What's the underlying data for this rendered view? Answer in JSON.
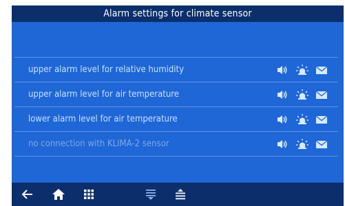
{
  "title": "Alarm settings for climate sensor",
  "alarms": [
    {
      "label": "upper alarm level for relative humidity"
    },
    {
      "label": "upper alarm level for air temperature"
    },
    {
      "label": "lower alarm level for air temperature"
    },
    {
      "label": "no connection with KLIMA-2 sensor"
    }
  ],
  "row_icons": [
    "speaker-icon",
    "beacon-icon",
    "envelope-icon"
  ],
  "nav_icons": [
    "back-arrow-icon",
    "home-icon",
    "grid-menu-icon",
    "scroll-down-icon",
    "scroll-up-icon"
  ],
  "colors": {
    "background": "#1f66d6",
    "title_bar": "#0b2f6b",
    "label_text": "#c4e0ff",
    "icon": "#d6e9ff",
    "divider": "#5f95e6"
  }
}
